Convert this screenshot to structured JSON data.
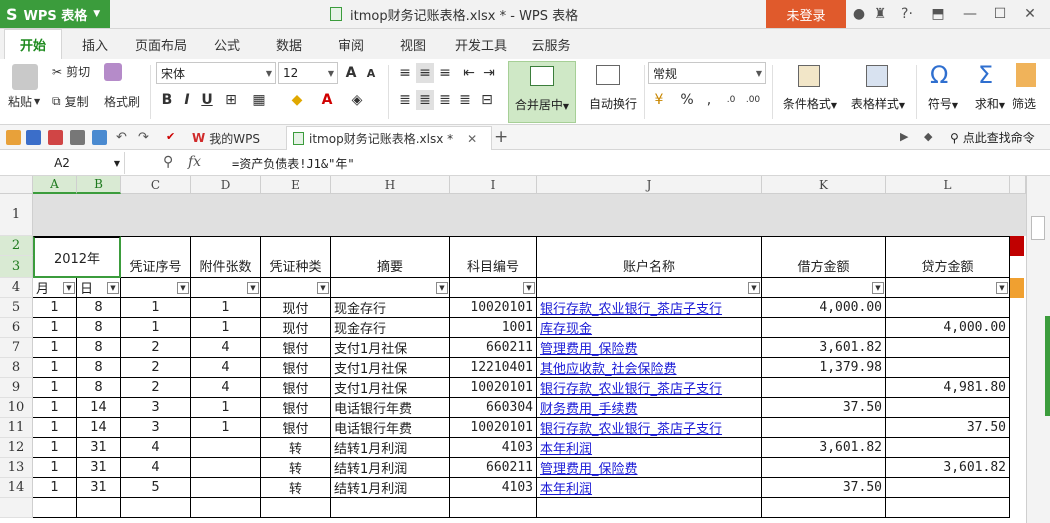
{
  "titlebar": {
    "app_name": "WPS 表格",
    "doc_title": "itmop财务记账表格.xlsx * - WPS 表格",
    "login_label": "未登录"
  },
  "ribbon_tabs": [
    "开始",
    "插入",
    "页面布局",
    "公式",
    "数据",
    "审阅",
    "视图",
    "开发工具",
    "云服务"
  ],
  "ribbon": {
    "paste_label": "粘贴",
    "cut_label": "剪切",
    "copy_label": "复制",
    "format_painter_label": "格式刷",
    "font_name": "宋体",
    "font_size": "12",
    "merge_center_label": "合并居中",
    "wrap_text_label": "自动换行",
    "number_format": "常规",
    "conditional_format_label": "条件格式",
    "table_style_label": "表格样式",
    "symbol_label": "符号",
    "sum_label": "求和",
    "filter_label": "筛选"
  },
  "docbar": {
    "tab1": "我的WPS",
    "tab2": "itmop财务记账表格.xlsx *",
    "find_command": "点此查找命令"
  },
  "formulabar": {
    "cell_ref": "A2",
    "fx": "fx",
    "formula": "=资产负债表!J1&\"年\""
  },
  "columns": [
    "A",
    "B",
    "C",
    "D",
    "E",
    "H",
    "I",
    "J",
    "K",
    "L"
  ],
  "rows": [
    "1",
    "2",
    "3",
    "4",
    "5",
    "6",
    "7",
    "8",
    "9",
    "10",
    "11",
    "12",
    "13",
    "14"
  ],
  "header": {
    "year": "2012年",
    "voucher_no": "凭证序号",
    "attachments": "附件张数",
    "voucher_type": "凭证种类",
    "summary": "摘要",
    "subject_code": "科目编号",
    "account_name": "账户名称",
    "debit": "借方金额",
    "credit": "贷方金额",
    "month": "月",
    "day": "日"
  },
  "data_rows": [
    {
      "month": "1",
      "day": "8",
      "voucher_no": "1",
      "attachments": "1",
      "type": "现付",
      "summary": "现金存行",
      "code": "10020101",
      "account": "银行存款_农业银行_茶店子支行",
      "debit": "4,000.00",
      "credit": ""
    },
    {
      "month": "1",
      "day": "8",
      "voucher_no": "1",
      "attachments": "1",
      "type": "现付",
      "summary": "现金存行",
      "code": "1001",
      "account": "库存现金",
      "debit": "",
      "credit": "4,000.00"
    },
    {
      "month": "1",
      "day": "8",
      "voucher_no": "2",
      "attachments": "4",
      "type": "银付",
      "summary": "支付1月社保",
      "code": "660211",
      "account": "管理费用_保险费",
      "debit": "3,601.82",
      "credit": ""
    },
    {
      "month": "1",
      "day": "8",
      "voucher_no": "2",
      "attachments": "4",
      "type": "银付",
      "summary": "支付1月社保",
      "code": "12210401",
      "account": "其他应收款_社会保险费",
      "debit": "1,379.98",
      "credit": ""
    },
    {
      "month": "1",
      "day": "8",
      "voucher_no": "2",
      "attachments": "4",
      "type": "银付",
      "summary": "支付1月社保",
      "code": "10020101",
      "account": "银行存款_农业银行_茶店子支行",
      "debit": "",
      "credit": "4,981.80"
    },
    {
      "month": "1",
      "day": "14",
      "voucher_no": "3",
      "attachments": "1",
      "type": "银付",
      "summary": "电话银行年费",
      "code": "660304",
      "account": "财务费用_手续费",
      "debit": "37.50",
      "credit": ""
    },
    {
      "month": "1",
      "day": "14",
      "voucher_no": "3",
      "attachments": "1",
      "type": "银付",
      "summary": "电话银行年费",
      "code": "10020101",
      "account": "银行存款_农业银行_茶店子支行",
      "debit": "",
      "credit": "37.50"
    },
    {
      "month": "1",
      "day": "31",
      "voucher_no": "4",
      "attachments": "",
      "type": "转",
      "summary": "结转1月利润",
      "code": "4103",
      "account": "本年利润",
      "debit": "3,601.82",
      "credit": ""
    },
    {
      "month": "1",
      "day": "31",
      "voucher_no": "4",
      "attachments": "",
      "type": "转",
      "summary": "结转1月利润",
      "code": "660211",
      "account": "管理费用_保险费",
      "debit": "",
      "credit": "3,601.82"
    },
    {
      "month": "1",
      "day": "31",
      "voucher_no": "5",
      "attachments": "",
      "type": "转",
      "summary": "结转1月利润",
      "code": "4103",
      "account": "本年利润",
      "debit": "37.50",
      "credit": ""
    }
  ],
  "colors": {
    "accent_green": "#3b9c3c",
    "login_orange": "#e05a2c",
    "link_blue": "#1a1ad6"
  }
}
